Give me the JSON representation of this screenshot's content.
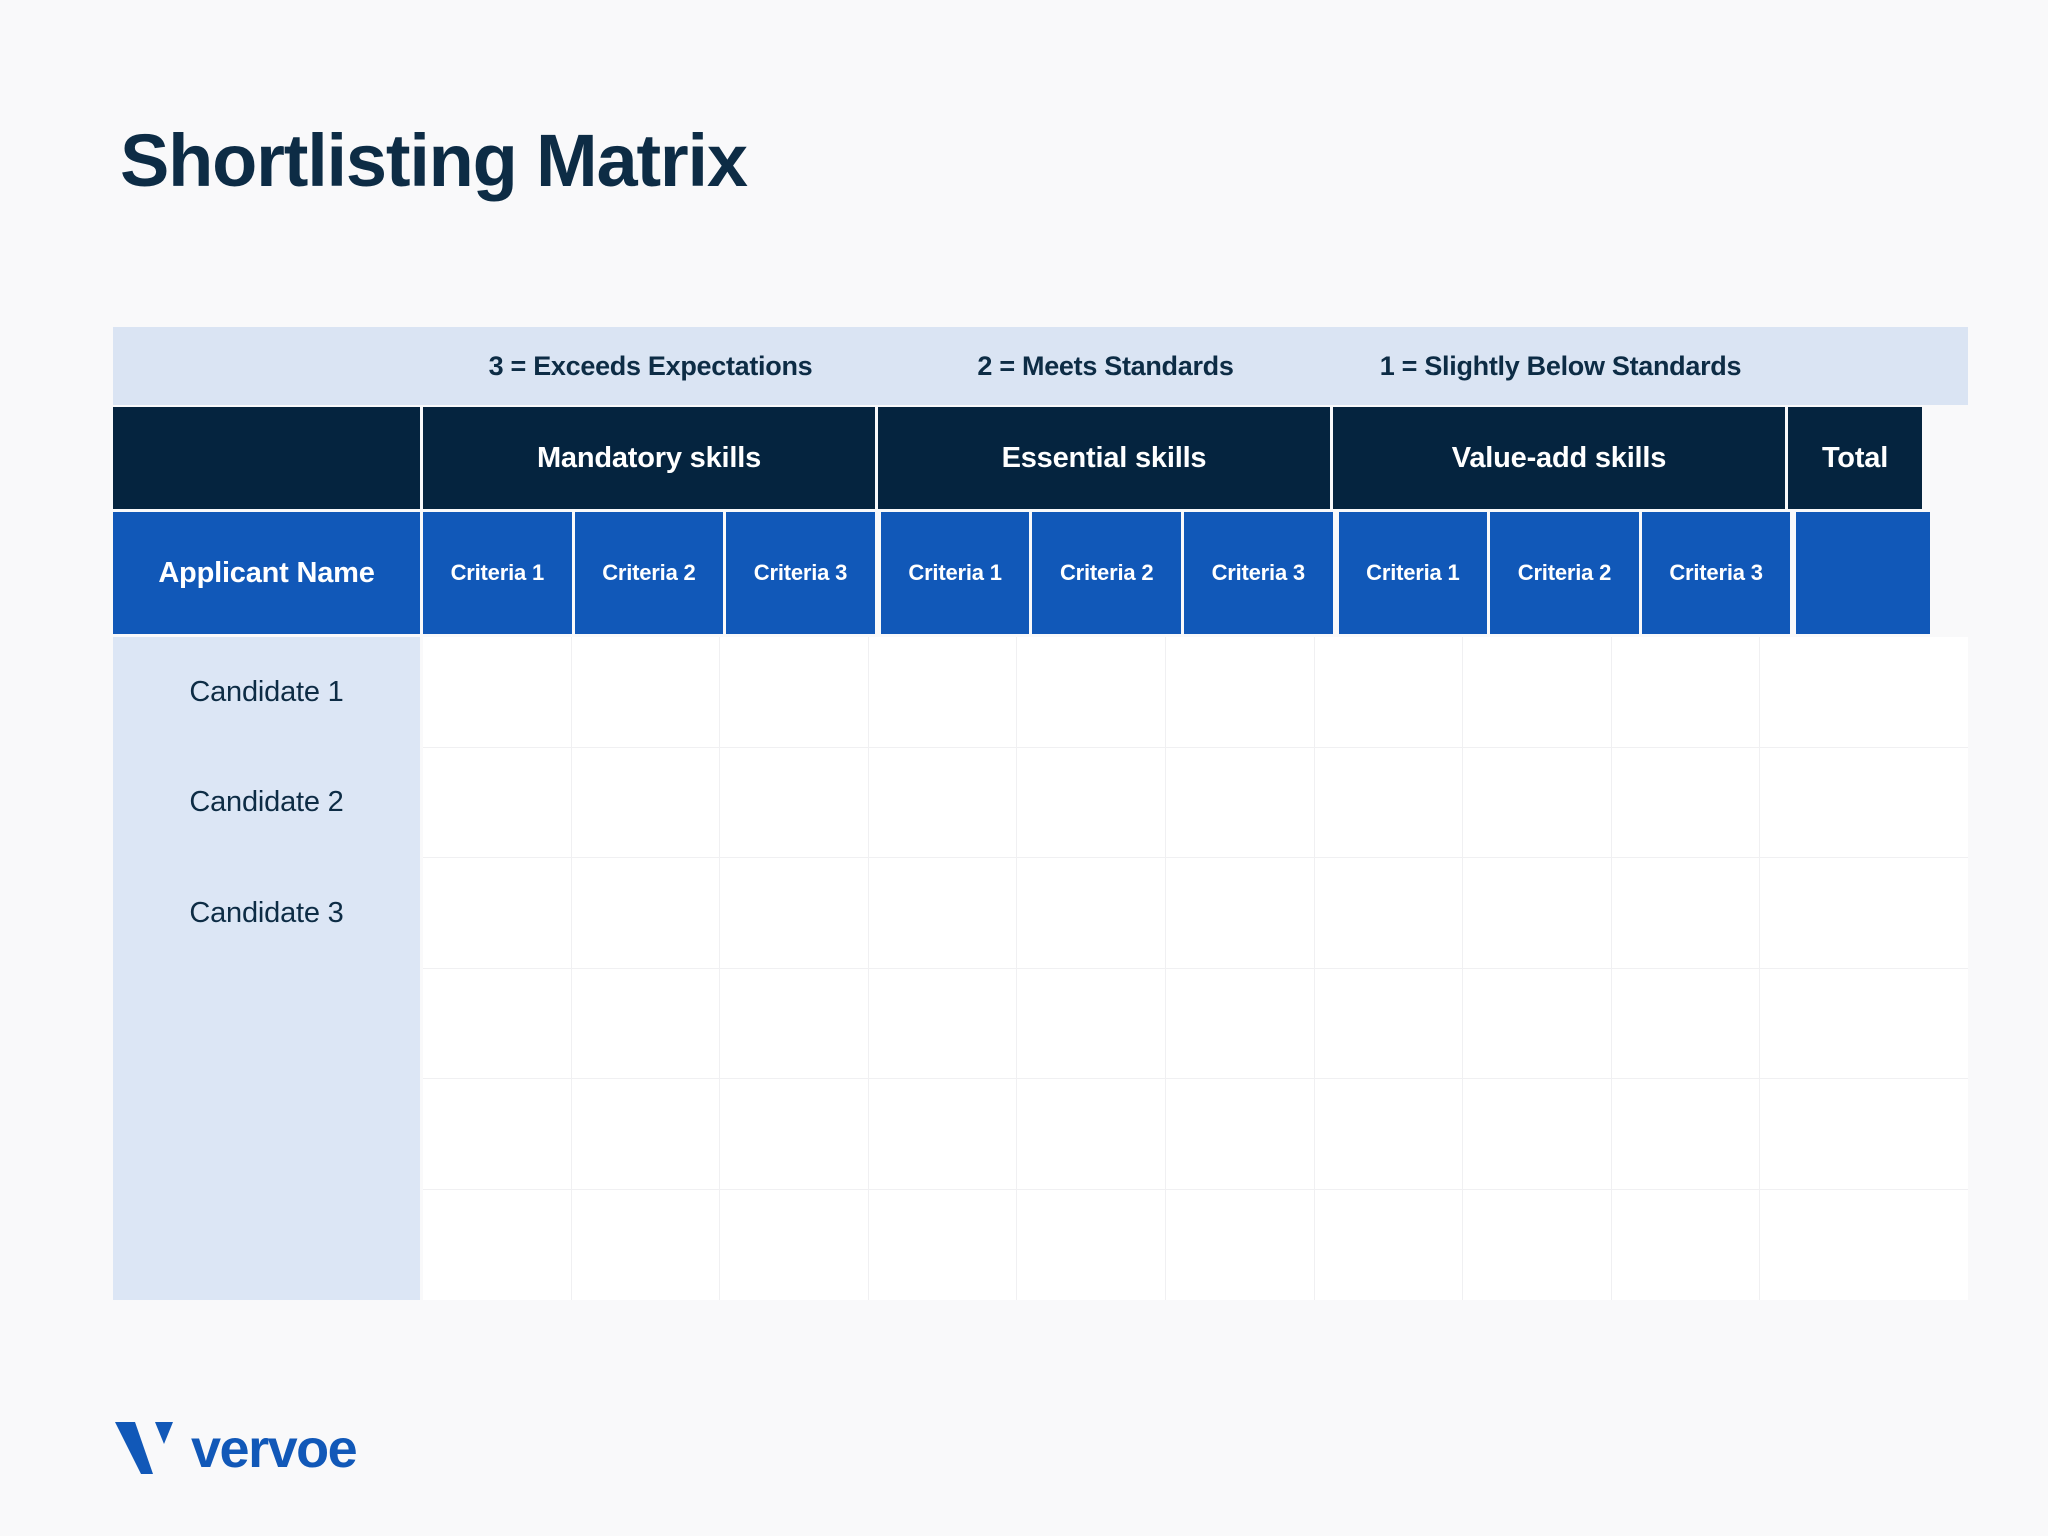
{
  "page": {
    "title": "Shortlisting Matrix",
    "background_color": "#f9f9fa",
    "title_color": "#0d2c45"
  },
  "colors": {
    "navy": "#05243f",
    "blue": "#1158b8",
    "legend_band": "#dae4f3",
    "name_column": "#dce6f5",
    "gridline": "#f0f0f2"
  },
  "legend": {
    "items": [
      {
        "label": "3 = Exceeds Expectations"
      },
      {
        "label": "2 = Meets Standards"
      },
      {
        "label": "1 = Slightly Below Standards"
      }
    ]
  },
  "table": {
    "group_headers": {
      "blank": "",
      "groups": [
        {
          "label": "Mandatory skills"
        },
        {
          "label": "Essential skills"
        },
        {
          "label": "Value-add skills"
        }
      ],
      "total": "Total"
    },
    "column_headers": {
      "applicant": "Applicant Name",
      "criteria": [
        "Criteria 1",
        "Criteria 2",
        "Criteria 3",
        "Criteria 1",
        "Criteria 2",
        "Criteria 3",
        "Criteria 1",
        "Criteria 2",
        "Criteria 3"
      ],
      "total": ""
    },
    "rows": [
      {
        "name": "Candidate 1",
        "scores": [
          "",
          "",
          "",
          "",
          "",
          "",
          "",
          "",
          ""
        ],
        "total": ""
      },
      {
        "name": "Candidate 2",
        "scores": [
          "",
          "",
          "",
          "",
          "",
          "",
          "",
          "",
          ""
        ],
        "total": ""
      },
      {
        "name": "Candidate 3",
        "scores": [
          "",
          "",
          "",
          "",
          "",
          "",
          "",
          "",
          ""
        ],
        "total": ""
      },
      {
        "name": "",
        "scores": [
          "",
          "",
          "",
          "",
          "",
          "",
          "",
          "",
          ""
        ],
        "total": ""
      },
      {
        "name": "",
        "scores": [
          "",
          "",
          "",
          "",
          "",
          "",
          "",
          "",
          ""
        ],
        "total": ""
      },
      {
        "name": "",
        "scores": [
          "",
          "",
          "",
          "",
          "",
          "",
          "",
          "",
          ""
        ],
        "total": ""
      }
    ]
  },
  "footer": {
    "logo_wordmark": "vervoe",
    "logo_icon": "vervoe-v-mark"
  }
}
